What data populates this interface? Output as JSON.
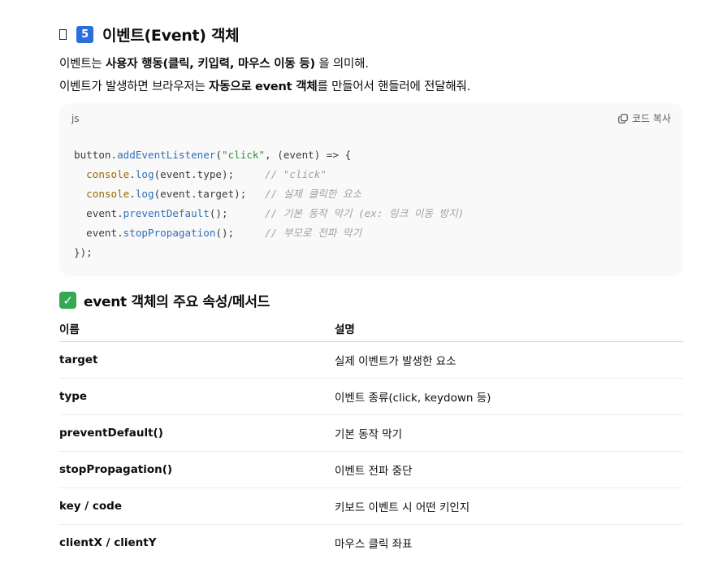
{
  "section": {
    "placeholder_glyph": "",
    "number": "5",
    "title": "이벤트(Event) 객체"
  },
  "intro": {
    "line1": {
      "prefix": "이벤트는 ",
      "bold": "사용자 행동(클릭, 키입력, 마우스 이동 등)",
      "suffix": " 을 의미해."
    },
    "line2": {
      "prefix": "이벤트가 발생하면 브라우저는 ",
      "bold1": "자동으로",
      "middle": " ",
      "bold2": "event 객체",
      "suffix": "를 만들어서 핸들러에 전달해줘."
    }
  },
  "code_block": {
    "language": "js",
    "copy_label": "코드 복사",
    "copy_icon": "copy-icon",
    "lines": [
      [
        {
          "t": "button.",
          "c": ""
        },
        {
          "t": "addEventListener",
          "c": "c-fn"
        },
        {
          "t": "(",
          "c": ""
        },
        {
          "t": "\"click\"",
          "c": "c-str"
        },
        {
          "t": ", (event) => {",
          "c": ""
        }
      ],
      [
        {
          "t": "  ",
          "c": ""
        },
        {
          "t": "console",
          "c": "c-obj"
        },
        {
          "t": ".",
          "c": ""
        },
        {
          "t": "log",
          "c": "c-fn"
        },
        {
          "t": "(event.type);     ",
          "c": ""
        },
        {
          "t": "// \"click\"",
          "c": "c-com"
        }
      ],
      [
        {
          "t": "  ",
          "c": ""
        },
        {
          "t": "console",
          "c": "c-obj"
        },
        {
          "t": ".",
          "c": ""
        },
        {
          "t": "log",
          "c": "c-fn"
        },
        {
          "t": "(event.target);   ",
          "c": ""
        },
        {
          "t": "// 실제 클릭한 요소",
          "c": "c-com"
        }
      ],
      [
        {
          "t": "  event.",
          "c": ""
        },
        {
          "t": "preventDefault",
          "c": "c-fn"
        },
        {
          "t": "();      ",
          "c": ""
        },
        {
          "t": "// 기본 동작 막기 (ex: 링크 이동 방지)",
          "c": "c-com"
        }
      ],
      [
        {
          "t": "  event.",
          "c": ""
        },
        {
          "t": "stopPropagation",
          "c": "c-fn"
        },
        {
          "t": "();     ",
          "c": ""
        },
        {
          "t": "// 부모로 전파 막기",
          "c": "c-com"
        }
      ],
      [
        {
          "t": "});",
          "c": ""
        }
      ]
    ]
  },
  "properties_heading": {
    "icon": "check-mark-icon",
    "text": "event 객체의 주요 속성/메서드"
  },
  "table": {
    "headers": [
      "이름",
      "설명"
    ],
    "rows": [
      [
        "target",
        "실제 이벤트가 발생한 요소"
      ],
      [
        "type",
        "이벤트 종류(click, keydown 등)"
      ],
      [
        "preventDefault()",
        "기본 동작 막기"
      ],
      [
        "stopPropagation()",
        "이벤트 전파 중단"
      ],
      [
        "key / code",
        "키보드 이벤트 시 어떤 키인지"
      ],
      [
        "clientX / clientY",
        "마우스 클릭 좌표"
      ]
    ]
  },
  "colors": {
    "badge_blue": "#2a6fdb",
    "check_green": "#34a853",
    "code_bg": "#f9f9f9"
  }
}
